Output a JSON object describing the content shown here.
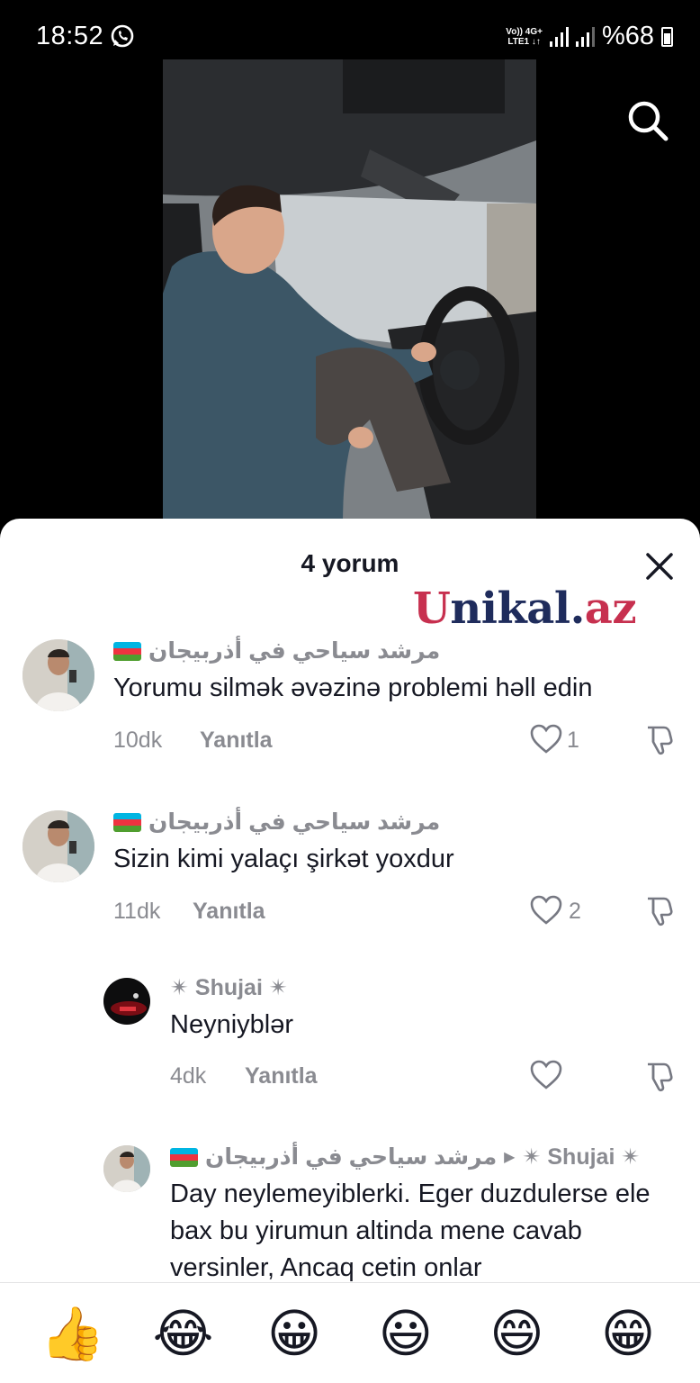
{
  "status_bar": {
    "time": "18:52",
    "network_top": "Vo)) 4G+",
    "network_bottom": "LTE1 ↓↑",
    "battery": "%68"
  },
  "sheet": {
    "title": "4 yorum",
    "watermark_u": "U",
    "watermark_mid": "nikal.",
    "watermark_az": "az"
  },
  "comments": [
    {
      "username": "مرشد سياحي في أذربيجان",
      "text": "Yorumu silmək əvəzinə problemi həll edin",
      "time": "10dk",
      "reply_label": "Yanıtla",
      "likes": "1"
    },
    {
      "username": "مرشد سياحي في أذربيجان",
      "text": "Sizin kimi yalaçı şirkət yoxdur",
      "time": "11dk",
      "reply_label": "Yanıtla",
      "likes": "2"
    },
    {
      "username": "✴ Shujai ✴",
      "text": "Neyniyblər",
      "time": "4dk",
      "reply_label": "Yanıtla",
      "likes": ""
    },
    {
      "username": "مرشد سياحي في أذربيجان",
      "reply_to": "✴ Shujai ✴",
      "text": "Day neylemeyiblerki. Eger duzdulerse ele bax bu yirumun altinda mene cavab versinler, Ancaq cetin onlar"
    }
  ],
  "emojis": [
    "👍",
    "😂",
    "😀",
    "😃",
    "😄",
    "😁"
  ],
  "colors": {
    "accent": "#c7304f",
    "muted_text": "#8a8b91",
    "flag_blue": "#00b5e2",
    "flag_red": "#ef3340",
    "flag_green": "#509e2f"
  }
}
